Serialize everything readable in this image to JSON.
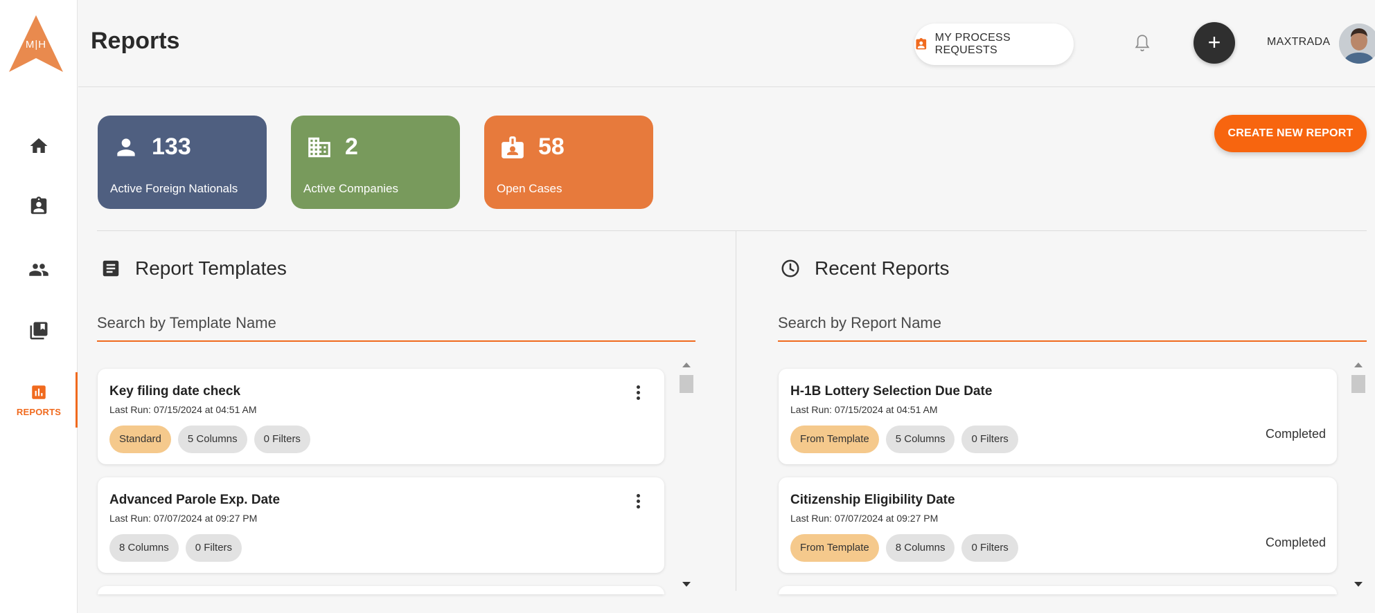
{
  "app": {
    "logo_text": "M|H",
    "brand_color": "#f06a1e"
  },
  "sidebar": {
    "items": [
      {
        "name": "home",
        "icon": "home-icon",
        "label": ""
      },
      {
        "name": "cases",
        "icon": "clipboard-person-icon",
        "label": ""
      },
      {
        "name": "people",
        "icon": "people-icon",
        "label": ""
      },
      {
        "name": "library",
        "icon": "library-books-icon",
        "label": ""
      },
      {
        "name": "reports",
        "icon": "bar-chart-icon",
        "label": "REPORTS",
        "active": true
      }
    ]
  },
  "header": {
    "title": "Reports",
    "process_requests_label": "MY PROCESS REQUESTS",
    "username": "MAXTRADA"
  },
  "stats": [
    {
      "value": "133",
      "label": "Active Foreign Nationals",
      "color": "#4f5f80",
      "icon": "person-icon"
    },
    {
      "value": "2",
      "label": "Active Companies",
      "color": "#789a5c",
      "icon": "building-icon"
    },
    {
      "value": "58",
      "label": "Open Cases",
      "color": "#e77a3c",
      "icon": "badge-icon"
    }
  ],
  "create_report_label": "CREATE NEW REPORT",
  "templates": {
    "title": "Report Templates",
    "search_placeholder": "Search by Template Name",
    "items": [
      {
        "title": "Key filing date check",
        "last_run": "Last Run: 07/15/2024 at 04:51 AM",
        "chips": [
          "Standard",
          "5 Columns",
          "0 Filters"
        ]
      },
      {
        "title": "Advanced Parole Exp. Date",
        "last_run": "Last Run: 07/07/2024 at 09:27 PM",
        "chips": [
          "8 Columns",
          "0 Filters"
        ]
      }
    ]
  },
  "recent": {
    "title": "Recent Reports",
    "search_placeholder": "Search by Report Name",
    "items": [
      {
        "title": "H-1B Lottery Selection Due Date",
        "last_run": "Last Run: 07/15/2024 at 04:51 AM",
        "chips": [
          "From Template",
          "5 Columns",
          "0 Filters"
        ],
        "status": "Completed"
      },
      {
        "title": "Citizenship Eligibility Date",
        "last_run": "Last Run: 07/07/2024 at 09:27 PM",
        "chips": [
          "From Template",
          "8 Columns",
          "0 Filters"
        ],
        "status": "Completed"
      }
    ]
  }
}
